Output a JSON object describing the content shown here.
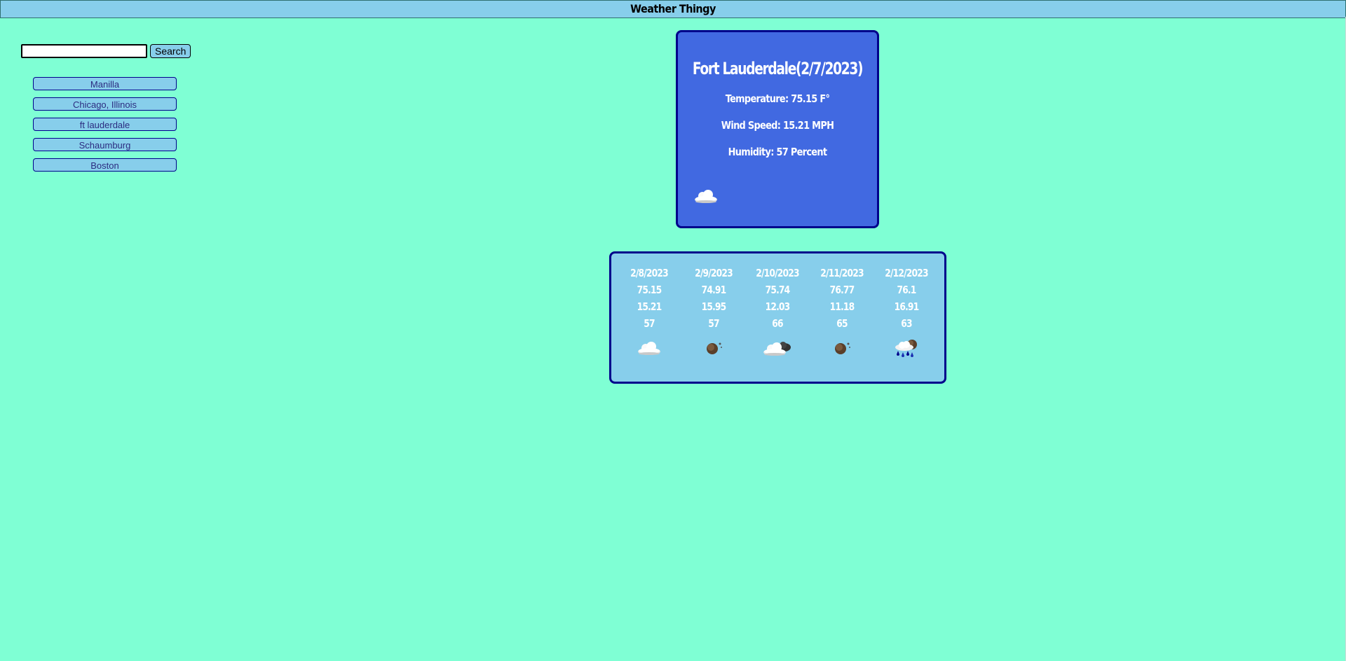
{
  "header": {
    "title": "Weather Thingy"
  },
  "search": {
    "value": "",
    "placeholder": "",
    "button_label": "Search"
  },
  "history": [
    {
      "label": "Manilla"
    },
    {
      "label": "Chicago, Illinois"
    },
    {
      "label": "ft lauderdale"
    },
    {
      "label": "Schaumburg"
    },
    {
      "label": "Boston"
    }
  ],
  "current": {
    "title": "Fort Lauderdale(2/7/2023)",
    "temperature": "Temperature: 75.15 F°",
    "wind": "Wind Speed: 15.21 MPH",
    "humidity": "Humidity: 57 Percent",
    "icon": "cloud-icon"
  },
  "forecast": [
    {
      "date": "2/8/2023",
      "temp": "75.15",
      "wind": "15.21",
      "humidity": "57",
      "icon": "cloud-icon"
    },
    {
      "date": "2/9/2023",
      "temp": "74.91",
      "wind": "15.95",
      "humidity": "57",
      "icon": "night-clear-icon"
    },
    {
      "date": "2/10/2023",
      "temp": "75.74",
      "wind": "12.03",
      "humidity": "66",
      "icon": "cloudy-night-icon"
    },
    {
      "date": "2/11/2023",
      "temp": "76.77",
      "wind": "11.18",
      "humidity": "65",
      "icon": "night-clear-icon"
    },
    {
      "date": "2/12/2023",
      "temp": "76.1",
      "wind": "16.91",
      "humidity": "63",
      "icon": "rain-night-icon"
    }
  ],
  "colors": {
    "background": "#7fffd4",
    "header": "#87ceeb",
    "current_card": "#4169e1",
    "forecast_card": "#87ceeb",
    "border": "#00008b"
  }
}
